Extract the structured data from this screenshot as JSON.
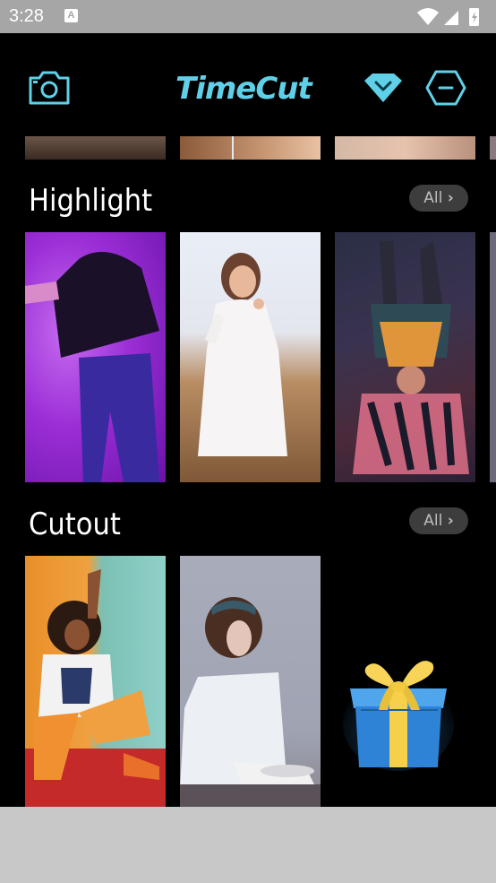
{
  "status_bar": {
    "time": "3:28",
    "a_badge": "A"
  },
  "header": {
    "logo_text": "TimeCut",
    "camera_icon": "camera-icon",
    "premium_icon": "diamond-icon",
    "menu_icon": "minus-hexagon-icon"
  },
  "sections": [
    {
      "title": "Highlight",
      "all_label": "All"
    },
    {
      "title": "Cutout",
      "all_label": "All"
    }
  ],
  "colors": {
    "accent": "#5fd0e8",
    "background": "#000000",
    "status_bar": "#a6a6a6"
  }
}
